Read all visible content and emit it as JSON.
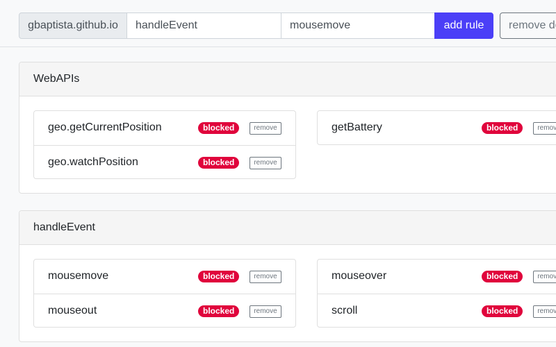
{
  "toolbar": {
    "domain": "gbaptista.github.io",
    "category_value": "handleEvent",
    "method_value": "mousemove",
    "add_rule_label": "add rule",
    "remove_domain_label": "remove domain"
  },
  "colors": {
    "primary": "#4b3ff7",
    "blocked_badge": "#e0043c"
  },
  "sections": [
    {
      "title": "WebAPIs",
      "columns": [
        [
          {
            "name": "geo.getCurrentPosition",
            "status": "blocked",
            "action": "remove"
          },
          {
            "name": "geo.watchPosition",
            "status": "blocked",
            "action": "remove"
          }
        ],
        [
          {
            "name": "getBattery",
            "status": "blocked",
            "action": "remove"
          }
        ]
      ]
    },
    {
      "title": "handleEvent",
      "columns": [
        [
          {
            "name": "mousemove",
            "status": "blocked",
            "action": "remove"
          },
          {
            "name": "mouseout",
            "status": "blocked",
            "action": "remove"
          }
        ],
        [
          {
            "name": "mouseover",
            "status": "blocked",
            "action": "remove"
          },
          {
            "name": "scroll",
            "status": "blocked",
            "action": "remove"
          }
        ]
      ]
    }
  ]
}
